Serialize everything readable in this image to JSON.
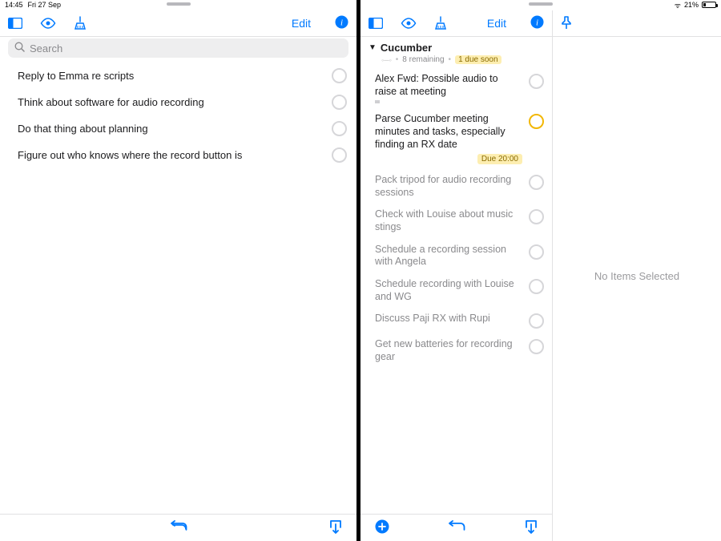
{
  "statusbar": {
    "time": "14:45",
    "date": "Fri 27 Sep",
    "battery_pct": "21%"
  },
  "left": {
    "edit": "Edit",
    "search_placeholder": "Search",
    "items": [
      "Reply to Emma re scripts",
      "Think about software for audio recording",
      "Do that thing about planning",
      "Figure out who knows where the record button is"
    ]
  },
  "right": {
    "edit": "Edit",
    "project": {
      "title": "Cucumber",
      "remaining": "8 remaining",
      "due_badge": "1 due soon"
    },
    "items": [
      {
        "title": "Alex Fwd: Possible audio to raise at meeting",
        "dim": false,
        "has_note": true,
        "due_badge": null,
        "due_circle": false
      },
      {
        "title": "Parse Cucumber meeting minutes and tasks, especially finding an RX date",
        "dim": false,
        "has_note": false,
        "due_badge": "Due 20:00",
        "due_circle": true
      },
      {
        "title": "Pack tripod for audio recording sessions",
        "dim": true,
        "has_note": false,
        "due_badge": null,
        "due_circle": false
      },
      {
        "title": "Check with Louise about music stings",
        "dim": true,
        "has_note": false,
        "due_badge": null,
        "due_circle": false
      },
      {
        "title": "Schedule a recording session with Angela",
        "dim": true,
        "has_note": false,
        "due_badge": null,
        "due_circle": false
      },
      {
        "title": "Schedule recording with Louise and WG",
        "dim": true,
        "has_note": false,
        "due_badge": null,
        "due_circle": false
      },
      {
        "title": "Discuss Paji RX with Rupi",
        "dim": true,
        "has_note": false,
        "due_badge": null,
        "due_circle": false
      },
      {
        "title": "Get new batteries for recording gear",
        "dim": true,
        "has_note": false,
        "due_badge": null,
        "due_circle": false
      }
    ],
    "detail_empty": "No Items Selected"
  },
  "icons": {
    "sidebar": "sidebar-icon",
    "eye": "eye-icon",
    "cleanup": "cleanup-icon",
    "info": "info-icon",
    "pin": "pin-icon",
    "add": "add-icon",
    "undo": "undo-icon",
    "share": "share-icon",
    "search": "search-icon"
  },
  "colors": {
    "tint": "#007aff",
    "due": "#f2b705",
    "badge_bg": "#fdeeb1"
  }
}
